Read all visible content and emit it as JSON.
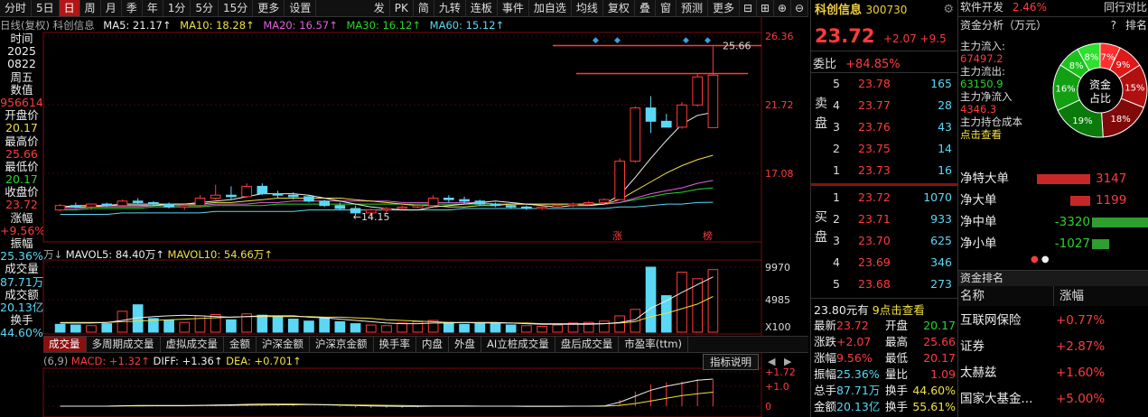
{
  "toolbar": {
    "items": [
      "分时",
      "5日",
      "日",
      "周",
      "月",
      "季",
      "年",
      "1分",
      "5分",
      "15分",
      "更多",
      "设置"
    ],
    "right_items": [
      "发",
      "PK",
      "简",
      "九转",
      "连板",
      "事件",
      "加自选",
      "均线",
      "复权",
      "叠",
      "窗",
      "预测",
      "更多"
    ]
  },
  "ma_legend": {
    "prefix": "日线(复权)  科创信息",
    "ma5": "MA5: 21.17↑",
    "ma10": "MA10: 18.28↑",
    "ma20": "MA20: 16.57↑",
    "ma30": "MA30: 16.12↑",
    "ma60": "MA60: 15.12↑"
  },
  "left_panel": {
    "rows": [
      "时间",
      "2025",
      "0822",
      "周五",
      "数值",
      "956614",
      "开盘价",
      "20.17",
      "最高价",
      "25.66",
      "最低价",
      "20.17",
      "收盘价",
      "23.72",
      "涨幅",
      "+9.56%",
      "振幅",
      "25.36%",
      "成交量",
      "87.71万",
      "成交额",
      "20.13亿",
      "换手",
      "44.60%"
    ]
  },
  "chart_data": [
    {
      "type": "candlestick",
      "title": "",
      "y_ticks": [
        "26.36",
        "21.72",
        "17.08"
      ],
      "annotations": [
        "25.66",
        "14.15",
        "涨",
        "榜"
      ],
      "ohlc": [
        [
          14.6,
          15.0,
          14.5,
          14.9
        ],
        [
          14.9,
          15.1,
          14.7,
          14.8
        ],
        [
          14.8,
          15.0,
          14.6,
          15.0
        ],
        [
          15.0,
          15.1,
          14.8,
          14.9
        ],
        [
          14.9,
          15.3,
          14.8,
          15.2
        ],
        [
          15.2,
          15.4,
          15.0,
          15.1
        ],
        [
          15.1,
          15.2,
          14.9,
          15.0
        ],
        [
          15.0,
          15.1,
          14.7,
          14.8
        ],
        [
          14.8,
          15.0,
          14.6,
          14.9
        ],
        [
          14.9,
          15.6,
          14.8,
          15.4
        ],
        [
          15.4,
          16.3,
          15.3,
          15.6
        ],
        [
          15.6,
          16.2,
          15.3,
          15.5
        ],
        [
          15.5,
          16.4,
          15.4,
          16.2
        ],
        [
          16.2,
          16.4,
          15.6,
          15.7
        ],
        [
          15.7,
          15.9,
          15.4,
          15.6
        ],
        [
          15.6,
          15.8,
          15.3,
          15.5
        ],
        [
          15.5,
          15.6,
          15.1,
          15.2
        ],
        [
          15.2,
          15.3,
          14.8,
          14.9
        ],
        [
          14.9,
          15.1,
          14.6,
          14.7
        ],
        [
          14.7,
          14.9,
          14.2,
          14.4
        ],
        [
          14.4,
          14.7,
          14.15,
          14.6
        ],
        [
          14.6,
          14.8,
          14.4,
          14.7
        ],
        [
          14.7,
          14.9,
          14.6,
          14.8
        ],
        [
          14.8,
          15.0,
          14.7,
          14.9
        ],
        [
          14.9,
          15.6,
          14.8,
          15.4
        ],
        [
          15.4,
          15.6,
          15.1,
          15.3
        ],
        [
          15.3,
          15.5,
          15.0,
          15.2
        ],
        [
          15.2,
          15.3,
          14.9,
          15.0
        ],
        [
          15.0,
          15.1,
          14.8,
          14.9
        ],
        [
          14.9,
          15.0,
          14.7,
          14.8
        ],
        [
          14.8,
          14.9,
          14.6,
          14.7
        ],
        [
          14.7,
          14.9,
          14.6,
          14.8
        ],
        [
          14.8,
          15.0,
          14.7,
          14.9
        ],
        [
          14.9,
          15.1,
          14.8,
          15.0
        ],
        [
          15.0,
          15.2,
          14.9,
          15.1
        ],
        [
          15.1,
          15.4,
          15.0,
          15.3
        ],
        [
          15.3,
          18.1,
          15.3,
          17.9
        ],
        [
          17.9,
          21.6,
          17.8,
          21.5
        ],
        [
          21.5,
          22.3,
          19.8,
          20.6
        ],
        [
          20.6,
          21.1,
          20.2,
          20.2
        ],
        [
          20.2,
          21.9,
          20.1,
          21.7
        ],
        [
          21.7,
          23.8,
          21.6,
          23.6
        ],
        [
          20.17,
          25.66,
          20.17,
          23.72
        ]
      ],
      "ma5": [
        14.8,
        14.9,
        14.9,
        14.9,
        15.0,
        15.0,
        15.0,
        15.0,
        15.0,
        15.1,
        15.2,
        15.3,
        15.5,
        15.7,
        15.7,
        15.7,
        15.6,
        15.4,
        15.2,
        15.0,
        14.8,
        14.7,
        14.6,
        14.6,
        14.8,
        14.9,
        15.0,
        15.1,
        15.2,
        15.1,
        15.0,
        14.9,
        14.8,
        14.9,
        14.9,
        15.0,
        15.6,
        16.8,
        18.1,
        19.3,
        20.4,
        21.0,
        21.2
      ],
      "ma10": [
        14.8,
        14.8,
        14.8,
        14.9,
        14.9,
        14.9,
        14.9,
        15.0,
        15.0,
        15.0,
        15.1,
        15.1,
        15.2,
        15.3,
        15.4,
        15.4,
        15.4,
        15.4,
        15.4,
        15.3,
        15.2,
        15.1,
        15.0,
        14.9,
        14.9,
        14.8,
        14.8,
        14.9,
        14.9,
        15.0,
        15.0,
        15.0,
        15.0,
        15.0,
        15.0,
        15.0,
        15.3,
        15.9,
        16.5,
        17.1,
        17.6,
        18.0,
        18.3
      ],
      "ma20": [
        14.7,
        14.7,
        14.8,
        14.8,
        14.8,
        14.8,
        14.9,
        14.9,
        14.9,
        14.9,
        15.0,
        15.0,
        15.0,
        15.1,
        15.1,
        15.2,
        15.2,
        15.2,
        15.2,
        15.2,
        15.2,
        15.2,
        15.1,
        15.1,
        15.1,
        15.1,
        15.1,
        15.1,
        15.0,
        15.0,
        15.0,
        15.0,
        15.0,
        15.0,
        15.0,
        15.0,
        15.1,
        15.4,
        15.7,
        15.9,
        16.1,
        16.4,
        16.6
      ],
      "ma30": [
        14.6,
        14.6,
        14.7,
        14.7,
        14.7,
        14.7,
        14.8,
        14.8,
        14.8,
        14.8,
        14.9,
        14.9,
        14.9,
        14.9,
        15.0,
        15.0,
        15.0,
        15.0,
        15.0,
        15.0,
        15.0,
        15.0,
        15.0,
        15.0,
        15.0,
        15.0,
        15.0,
        15.0,
        15.0,
        15.0,
        15.0,
        15.0,
        15.0,
        15.0,
        15.0,
        15.0,
        15.1,
        15.3,
        15.5,
        15.7,
        15.8,
        16.0,
        16.1
      ],
      "ma60": [
        14.3,
        14.3,
        14.3,
        14.3,
        14.4,
        14.4,
        14.4,
        14.4,
        14.4,
        14.4,
        14.5,
        14.5,
        14.5,
        14.5,
        14.5,
        14.5,
        14.6,
        14.6,
        14.6,
        14.6,
        14.6,
        14.6,
        14.6,
        14.6,
        14.6,
        14.6,
        14.7,
        14.7,
        14.7,
        14.7,
        14.7,
        14.7,
        14.7,
        14.7,
        14.7,
        14.7,
        14.8,
        14.8,
        14.9,
        15.0,
        15.0,
        15.1,
        15.12
      ],
      "ylim": [
        14.0,
        26.6
      ]
    },
    {
      "type": "bar",
      "title": "",
      "y_ticks": [
        "9970",
        "4985",
        "X100"
      ],
      "volume": [
        1200,
        1100,
        1000,
        1300,
        3200,
        4200,
        2100,
        1800,
        1500,
        2500,
        2700,
        1900,
        2800,
        2600,
        2400,
        2000,
        1700,
        2100,
        1600,
        1300,
        1100,
        1000,
        1400,
        1600,
        1800,
        1500,
        1200,
        1300,
        1400,
        1100,
        1000,
        900,
        1100,
        1400,
        1500,
        1700,
        2500,
        3500,
        9970,
        5600,
        9200,
        8200,
        9600
      ],
      "mavol5": [
        1400,
        1400,
        1400,
        1500,
        1800,
        2200,
        2400,
        2500,
        2600,
        2500,
        2400,
        2300,
        2400,
        2500,
        2500,
        2500,
        2300,
        2200,
        2000,
        1800,
        1600,
        1400,
        1300,
        1300,
        1400,
        1400,
        1500,
        1500,
        1500,
        1400,
        1300,
        1200,
        1200,
        1200,
        1200,
        1300,
        1500,
        1900,
        3700,
        4800,
        6100,
        7300,
        8480
      ],
      "mavol10": [
        1500,
        1500,
        1500,
        1500,
        1600,
        1700,
        1800,
        1900,
        2000,
        2100,
        2200,
        2300,
        2400,
        2400,
        2400,
        2400,
        2400,
        2300,
        2300,
        2200,
        2100,
        1900,
        1800,
        1700,
        1600,
        1500,
        1500,
        1400,
        1400,
        1400,
        1400,
        1300,
        1300,
        1300,
        1300,
        1300,
        1400,
        1600,
        2400,
        2900,
        3600,
        4300,
        5466
      ],
      "down_days": [
        0,
        1,
        3,
        5,
        6,
        7,
        11,
        13,
        14,
        15,
        16,
        17,
        18,
        19,
        25,
        26,
        27,
        28,
        29,
        38,
        39
      ]
    },
    {
      "type": "line",
      "title": "",
      "y_ticks": [
        "+1.72",
        "+1.0",
        "0"
      ],
      "diff": [
        0,
        0,
        0,
        0,
        0.02,
        0.03,
        0.03,
        0.03,
        0.03,
        0.04,
        0.06,
        0.07,
        0.09,
        0.1,
        0.1,
        0.1,
        0.09,
        0.07,
        0.05,
        0.03,
        0.01,
        0,
        -0.01,
        -0.01,
        0,
        0,
        0,
        0,
        0,
        0,
        -0.01,
        -0.01,
        -0.01,
        0,
        0,
        0.01,
        0.2,
        0.5,
        0.8,
        1.0,
        1.15,
        1.3,
        1.36
      ],
      "dea": [
        0,
        0,
        0,
        0,
        0.01,
        0.01,
        0.02,
        0.02,
        0.02,
        0.03,
        0.03,
        0.04,
        0.05,
        0.06,
        0.07,
        0.07,
        0.08,
        0.08,
        0.07,
        0.06,
        0.05,
        0.04,
        0.03,
        0.02,
        0.01,
        0.01,
        0.01,
        0,
        0,
        0,
        0,
        0,
        0,
        0,
        0,
        0,
        0.04,
        0.13,
        0.26,
        0.4,
        0.53,
        0.62,
        0.701
      ],
      "ylim": [
        -0.3,
        1.8
      ]
    }
  ],
  "vol_legend": {
    "prefix": "万↓",
    "mavol5": "MAVOL5: 84.40万↑",
    "mavol10": "MAVOL10: 54.66万↑"
  },
  "indicator_tabs": [
    "成交量",
    "多周期成交量",
    "虚拟成交量",
    "金额",
    "沪深金额",
    "沪深京金额",
    "换手率",
    "内盘",
    "外盘",
    "AI立桩成交量",
    "盘后成交量",
    "市盈率(ttm)"
  ],
  "macd_legend": {
    "prefix": "(6,9)",
    "macd": "MACD: +1.32↑",
    "diff": "DIFF: +1.36↑",
    "dea": "DEA: +0.701↑",
    "button": "指标说明"
  },
  "quote": {
    "name": "科创信息",
    "code": "300730",
    "price": "23.72",
    "change": "+2.07",
    "change_pct": "+9.5",
    "weibi_label": "委比",
    "weibi": "+84.85%",
    "sell_label": "卖盘",
    "buy_label": "买盘",
    "sell": [
      {
        "lv": "5",
        "px": "23.78",
        "qty": "165"
      },
      {
        "lv": "4",
        "px": "23.77",
        "qty": "28"
      },
      {
        "lv": "3",
        "px": "23.76",
        "qty": "43"
      },
      {
        "lv": "2",
        "px": "23.75",
        "qty": "14"
      },
      {
        "lv": "1",
        "px": "23.73",
        "qty": "16"
      }
    ],
    "buy": [
      {
        "lv": "1",
        "px": "23.72",
        "qty": "1070"
      },
      {
        "lv": "2",
        "px": "23.71",
        "qty": "933"
      },
      {
        "lv": "3",
        "px": "23.70",
        "qty": "625"
      },
      {
        "lv": "4",
        "px": "23.69",
        "qty": "346"
      },
      {
        "lv": "5",
        "px": "23.68",
        "qty": "273"
      }
    ],
    "notice": "23.80元有",
    "notice_link": "9点击查看",
    "stats": [
      [
        "最新",
        "23.72",
        "开盘",
        "20.17"
      ],
      [
        "涨跌",
        "+2.07",
        "最高",
        "25.66"
      ],
      [
        "涨幅",
        "9.56%",
        "最低",
        "20.17"
      ],
      [
        "振幅",
        "25.36%",
        "量比",
        "1.09"
      ],
      [
        "总手",
        "87.71万",
        "换手",
        "44.60%"
      ],
      [
        "金额",
        "20.13亿",
        "换手",
        "55.61%"
      ]
    ]
  },
  "fund": {
    "sector": "软件开发",
    "sector_pct": "2.46%",
    "compare": "同行对比",
    "analysis_title": "资金分析（万元）",
    "help": "?",
    "rank_label": "排名",
    "inflow_label": "主力流入:",
    "inflow": "67497.2",
    "outflow_label": "主力流出:",
    "outflow": "63150.9",
    "net_label": "主力净流入",
    "net": "4346.3",
    "cost_label": "主力持仓成本",
    "cost_link": "点击查看",
    "donut_center": [
      "资金",
      "占比"
    ],
    "donut": [
      {
        "label": "7%",
        "value": 7,
        "color": "#ff3030"
      },
      {
        "label": "9%",
        "value": 9,
        "color": "#e01818"
      },
      {
        "label": "15%",
        "value": 15,
        "color": "#b01010"
      },
      {
        "label": "18%",
        "value": 18,
        "color": "#800a0a"
      },
      {
        "label": "19%",
        "value": 19,
        "color": "#0a7a0a"
      },
      {
        "label": "16%",
        "value": 16,
        "color": "#12a012"
      },
      {
        "label": "8%",
        "value": 8,
        "color": "#1cc21c"
      },
      {
        "label": "8%",
        "value": 8,
        "color": "#30e030"
      }
    ],
    "flows": [
      {
        "label": "净特大单",
        "value": "3147",
        "num": 3147,
        "color": "#c62828"
      },
      {
        "label": "净大单",
        "value": "1199",
        "num": 1199,
        "color": "#c62828"
      },
      {
        "label": "净中单",
        "value": "-3320",
        "num": -3320,
        "color": "#2e9e2e"
      },
      {
        "label": "净小单",
        "value": "-1027",
        "num": -1027,
        "color": "#2e9e2e"
      }
    ],
    "rank_title": "资金排名",
    "rank_cols": [
      "名称",
      "涨幅"
    ],
    "ranks": [
      {
        "name": "互联网保险",
        "pct": "+0.77%"
      },
      {
        "name": "证券",
        "pct": "+2.87%"
      },
      {
        "name": "太赫兹",
        "pct": "+1.60%"
      },
      {
        "name": "国家大基金...",
        "pct": "+5.00%"
      }
    ]
  }
}
